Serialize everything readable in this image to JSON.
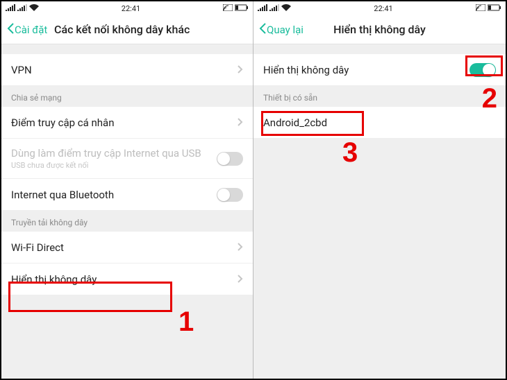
{
  "statusbar": {
    "time": "22:41"
  },
  "left": {
    "back_label": "Cài đặt",
    "title": "Các kết nối không dây khác",
    "rows": {
      "vpn": "VPN",
      "section_share": "Chia sẻ mạng",
      "hotspot": "Điểm truy cập cá nhân",
      "usb_tether": "Dùng làm điểm truy cập Internet qua USB",
      "usb_sub": "USB chưa được kết nối",
      "bt_internet": "Internet qua Bluetooth",
      "section_wireless": "Truyền tải không dây",
      "wifi_direct": "Wi-Fi Direct",
      "wireless_display": "Hiển thị không dây"
    }
  },
  "right": {
    "back_label": "Quay lại",
    "title": "Hiển thị không dây",
    "toggle_label": "Hiển thị không dây",
    "section_devices": "Thiết bị có sẵn",
    "device_name": "Android_2cbd"
  },
  "annotations": {
    "n1": "1",
    "n2": "2",
    "n3": "3"
  }
}
